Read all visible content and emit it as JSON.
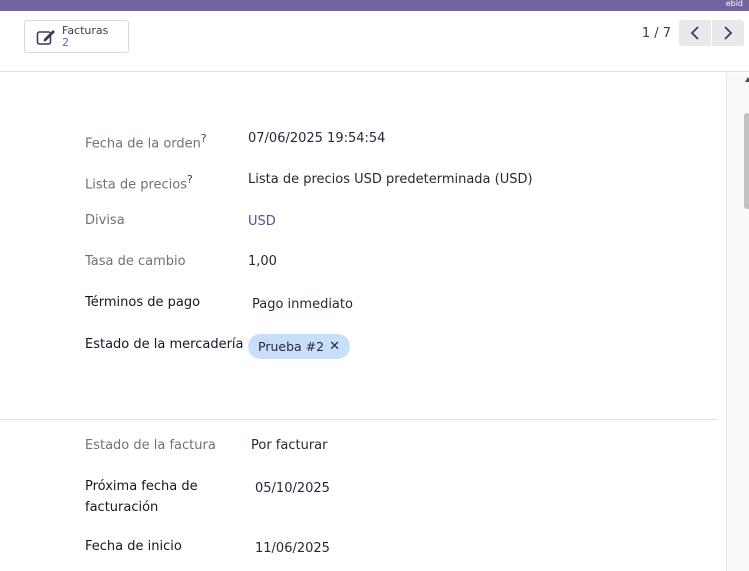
{
  "topbar": {
    "badge": "ebid"
  },
  "smart_button": {
    "label": "Facturas",
    "count": "2"
  },
  "pager": {
    "text": "1 / 7"
  },
  "fields": {
    "order_date": {
      "label": "Fecha de la orden",
      "help": "?",
      "value": "07/06/2025 19:54:54"
    },
    "pricelist": {
      "label": "Lista de precios",
      "help": "?",
      "value": "Lista de precios USD predeterminada (USD)"
    },
    "currency": {
      "label": "Divisa",
      "value": "USD"
    },
    "exchange_rate": {
      "label": "Tasa de cambio",
      "value": "1,00"
    },
    "payment_terms": {
      "label": "Términos de pago",
      "value": "Pago inmediato"
    },
    "goods_state": {
      "label": "Estado de la mercadería",
      "tag": "Prueba #2"
    },
    "invoice_state": {
      "label": "Estado de la factura",
      "value": "Por facturar"
    },
    "next_invoice_date": {
      "label_line1": "Próxima fecha de",
      "label_line2": "facturación",
      "value": "05/10/2025"
    },
    "start_date": {
      "label": "Fecha de inicio",
      "value": "11/06/2025"
    }
  },
  "colors": {
    "brand": "#71639e",
    "tag_bg": "#c7dffb",
    "link": "#5b4f90"
  }
}
